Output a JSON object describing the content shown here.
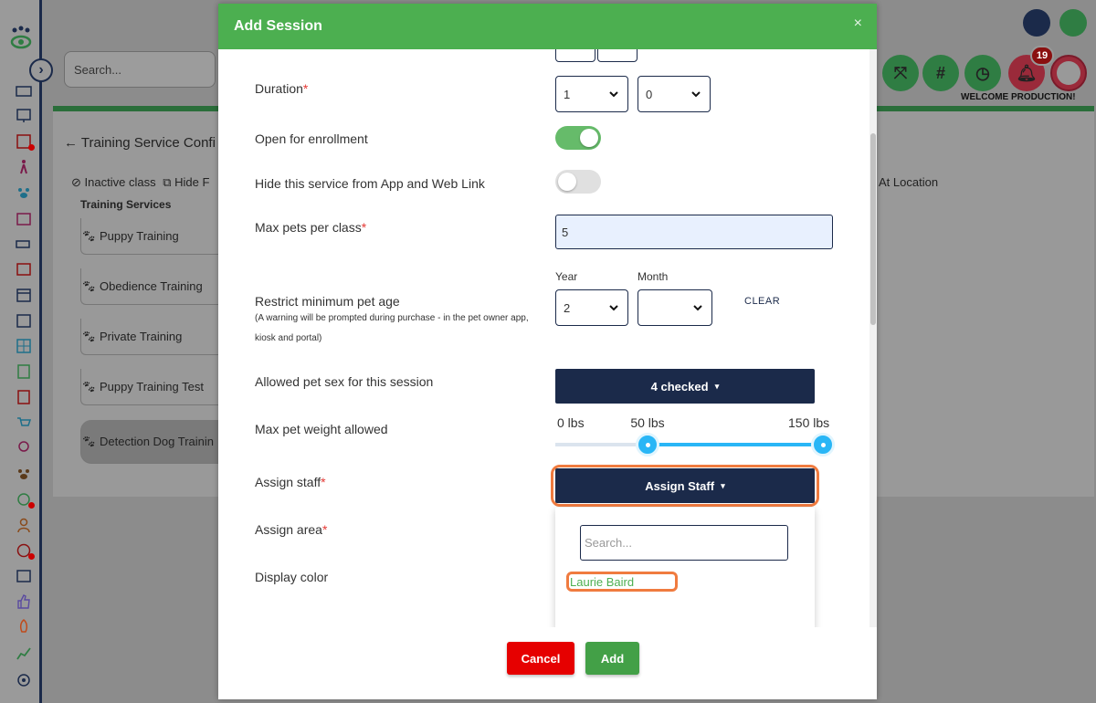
{
  "top": {
    "search_placeholder": "Search...",
    "welcome": "WELCOME PRODUCTION!",
    "notification_count": "19",
    "hash_symbol": "#"
  },
  "page": {
    "title": "Training Service Confi",
    "filter_inactive": "Inactive class",
    "filter_hide": "Hide F",
    "at_location": "At Location",
    "services_header": "Training Services",
    "services": [
      "Puppy Training",
      "Obedience Training",
      "Private Training",
      "Puppy Training Test",
      "Detection Dog Trainin"
    ]
  },
  "modal": {
    "title": "Add Session",
    "close": "×",
    "duration_label": "Duration",
    "duration_hours": "1",
    "duration_minutes": "0",
    "open_enrollment_label": "Open for enrollment",
    "open_enrollment_on": true,
    "hide_service_label": "Hide this service from App and Web Link",
    "hide_service_on": false,
    "max_pets_label": "Max pets per class",
    "max_pets_value": "5",
    "min_age_label": "Restrict minimum pet age",
    "min_age_note": "(A warning will be prompted during purchase - in the pet owner app, kiosk and portal)",
    "year_label": "Year",
    "month_label": "Month",
    "year_value": "2",
    "month_value": "",
    "clear_label": "CLEAR",
    "pet_sex_label": "Allowed pet sex for this session",
    "pet_sex_button": "4 checked",
    "max_weight_label": "Max pet weight allowed",
    "weight_min_label": "0 lbs",
    "weight_low_label": "50 lbs",
    "weight_max_label": "150 lbs",
    "weight_range": {
      "min": 0,
      "max": 150,
      "low": 50,
      "high": 150
    },
    "assign_staff_label": "Assign staff",
    "assign_staff_button": "Assign Staff",
    "staff_search_placeholder": "Search...",
    "staff_options": [
      "Laurie Baird"
    ],
    "assign_area_label": "Assign area",
    "display_color_label": "Display color",
    "required_mark": "*",
    "cancel_label": "Cancel",
    "add_label": "Add"
  },
  "colors": {
    "header_green": "#4caf50",
    "navy": "#1b2a4a",
    "cancel_red": "#e60000",
    "highlight_orange": "#f07b3f",
    "slider_blue": "#29b6f6"
  }
}
